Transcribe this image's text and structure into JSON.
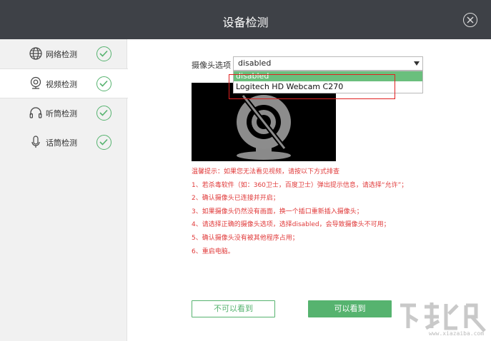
{
  "window": {
    "title": "设备检测"
  },
  "sidebar": {
    "items": [
      {
        "label": "网络检测",
        "icon": "globe-icon",
        "status": "passed"
      },
      {
        "label": "视频检测",
        "icon": "webcam-icon",
        "status": "passed",
        "active": true
      },
      {
        "label": "听筒检测",
        "icon": "headphones-icon",
        "status": "passed"
      },
      {
        "label": "话筒检测",
        "icon": "microphone-icon",
        "status": "passed"
      }
    ]
  },
  "camera": {
    "label": "摄像头选项",
    "selected": "disabled",
    "options": [
      "disabled",
      "Logitech HD Webcam C270"
    ]
  },
  "tips": {
    "lines": [
      "温馨提示：如果您无法看见视频，请按以下方式排查",
      "1、若杀毒软件（如：360卫士，百度卫士）弹出提示信息，请选择“允许”；",
      "2、确认摄像头已连接并开启；",
      "3、如果摄像头仍然没有画面，换一个插口重新插入摄像头；",
      "4、请选择正确的摄像头选项，选择disabled，会导致摄像头不可用；",
      "5、确认摄像头没有被其他程序占用；",
      "6、重启电脑。"
    ]
  },
  "buttons": {
    "cannot_see": "不可以看到",
    "can_see": "可以看到"
  },
  "watermark": {
    "text": "www.xiazaiba.com"
  },
  "colors": {
    "accent": "#56b36f",
    "titlebar": "#3e4147",
    "tip_red": "#e03a3a",
    "highlight_box": "#e02020"
  }
}
